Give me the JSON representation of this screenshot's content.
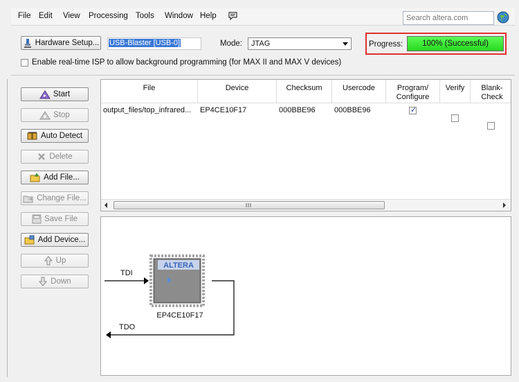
{
  "menu": [
    "File",
    "Edit",
    "View",
    "Processing",
    "Tools",
    "Window",
    "Help"
  ],
  "search": {
    "placeholder": "Search altera.com"
  },
  "toolbar": {
    "hardware_setup_label": "Hardware Setup...",
    "hardware_value": "USB-Blaster [USB-0]",
    "mode_label": "Mode:",
    "mode_value": "JTAG",
    "progress_label": "Progress:",
    "progress_text": "100% (Successful)",
    "progress_percent": 100,
    "isp_label": "Enable real-time ISP to allow background programming (for MAX II and MAX V devices)",
    "isp_checked": false
  },
  "side_buttons": {
    "start": "Start",
    "stop": "Stop",
    "auto_detect": "Auto Detect",
    "delete": "Delete",
    "add_file": "Add File...",
    "change_file": "Change File...",
    "save_file": "Save File",
    "add_device": "Add Device...",
    "up": "Up",
    "down": "Down"
  },
  "table": {
    "columns": [
      "File",
      "Device",
      "Checksum",
      "Usercode",
      "Program/ Configure",
      "Verify",
      "Blank- Check"
    ],
    "rows": [
      {
        "file": "output_files/top_infrared...",
        "device": "EP4CE10F17",
        "checksum": "000BBE96",
        "usercode": "000BBE96",
        "program_configure": true,
        "verify": false,
        "blank_check": false
      }
    ]
  },
  "chain": {
    "tdi": "TDI",
    "tdo": "TDO",
    "chip_brand": "ALTERA",
    "device": "EP4CE10F17"
  },
  "colors": {
    "progress_fill": "#27d81f",
    "highlight_frame": "#e0312d",
    "selection": "#3a78d6"
  }
}
